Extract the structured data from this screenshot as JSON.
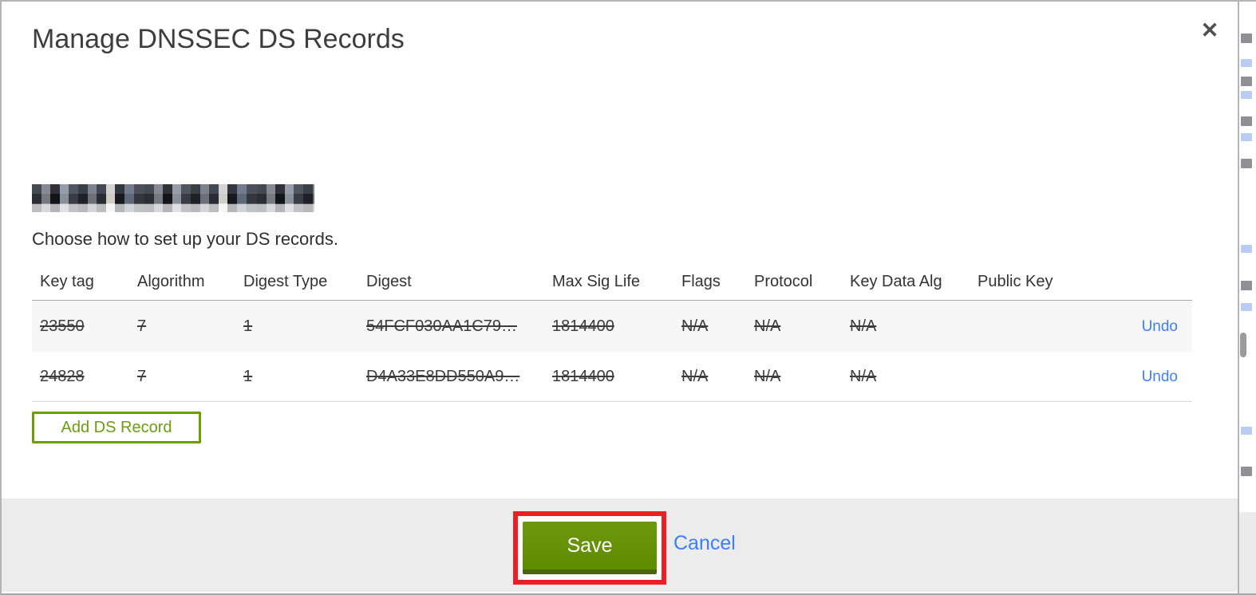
{
  "dialog": {
    "title": "Manage DNSSEC DS Records",
    "close_icon": "✕",
    "instruction": "Choose how to set up your DS records.",
    "table": {
      "columns": [
        "Key tag",
        "Algorithm",
        "Digest Type",
        "Digest",
        "Max Sig Life",
        "Flags",
        "Protocol",
        "Key Data Alg",
        "Public Key"
      ],
      "rows": [
        {
          "key_tag": "23550",
          "algorithm": "7",
          "digest_type": "1",
          "digest": "54FCF030AA1C79…",
          "max_sig_life": "1814400",
          "flags": "N/A",
          "protocol": "N/A",
          "key_data_alg": "N/A",
          "public_key": "",
          "action": "Undo"
        },
        {
          "key_tag": "24828",
          "algorithm": "7",
          "digest_type": "1",
          "digest": "D4A33E8DD550A9…",
          "max_sig_life": "1814400",
          "flags": "N/A",
          "protocol": "N/A",
          "key_data_alg": "N/A",
          "public_key": "",
          "action": "Undo"
        }
      ]
    },
    "add_record_button": "Add DS Record",
    "footer": {
      "save_label": "Save",
      "cancel_label": "Cancel"
    },
    "colors": {
      "save_green": "#628e00",
      "outline_green": "#6b9e05",
      "link_blue": "#3c7efc",
      "annotation_red": "#ec1f26",
      "footer_gray": "#ececec"
    }
  }
}
